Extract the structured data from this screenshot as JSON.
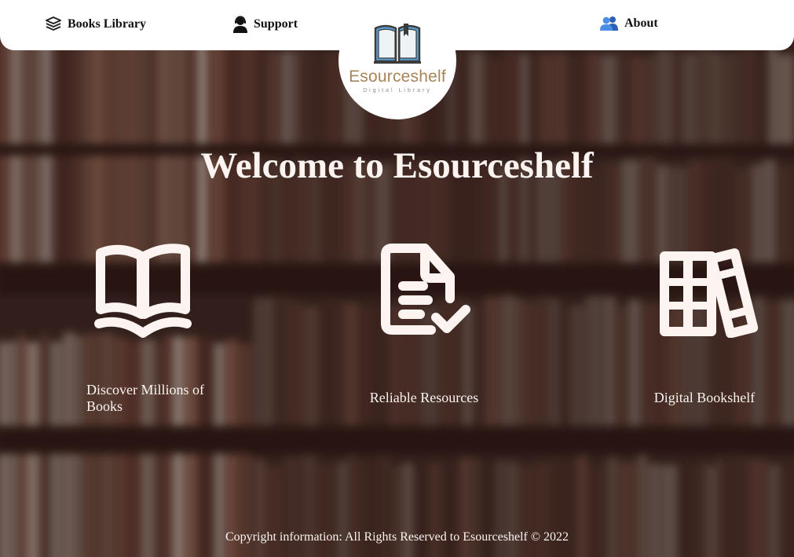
{
  "navbar": {
    "books_library": "Books Library",
    "support": "Support",
    "about": "About",
    "books_icon": "stacked-books-icon",
    "support_icon": "headset-user-icon",
    "about_icon": "users-icon"
  },
  "logo": {
    "name_prefix": "Esource",
    "name_suffix": "shelf",
    "tagline": "Digital Library",
    "icon": "open-book-icon"
  },
  "hero": {
    "title": "Welcome to Esourceshelf"
  },
  "features": [
    {
      "label": "Discover Millions of Books",
      "icon": "open-book-icon"
    },
    {
      "label": "Reliable Resources",
      "icon": "document-check-icon"
    },
    {
      "label": "Digital Bookshelf",
      "icon": "bookshelf-icon"
    }
  ],
  "footer": {
    "text": "Copyright information: All Rights Reserved to Esourceshelf © 2022"
  },
  "colors": {
    "navbar_bg": "#ffffff",
    "text_light": "#fbf4f1",
    "logo_gold": "#a7845a",
    "logo_book_blue": "#5a9fd0",
    "about_icon_blue": "#3f7fd8",
    "background_tint": "#3a2722"
  }
}
